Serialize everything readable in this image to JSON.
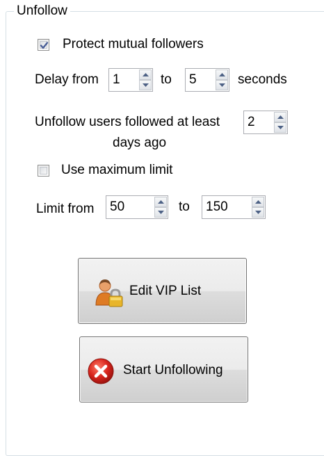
{
  "group": {
    "title": "Unfollow"
  },
  "protect_mutual": {
    "label": "Protect mutual followers",
    "checked": true
  },
  "delay": {
    "prefix": "Delay from",
    "from_value": "1",
    "to_label": "to",
    "to_value": "5",
    "suffix": "seconds"
  },
  "unfollow_age": {
    "label_line1": "Unfollow users followed at least",
    "value": "2",
    "label_line2": "days ago"
  },
  "max_limit": {
    "label": "Use maximum limit",
    "checked": false
  },
  "limit": {
    "prefix": "Limit from",
    "from_value": "50",
    "to_label": "to",
    "to_value": "150"
  },
  "buttons": {
    "edit_vip": "Edit VIP List",
    "start_unfollowing": "Start Unfollowing"
  },
  "icons": {
    "edit_vip": "user-lock-icon",
    "start_unfollowing": "red-x-circle-icon",
    "spin_up": "triangle-up-icon",
    "spin_down": "triangle-down-icon",
    "check": "checkmark-icon"
  },
  "colors": {
    "groupbox_border": "#d5dfe5",
    "checkmark": "#4a5f97",
    "stop_red": "#d8251d",
    "lock_gold": "#d8a51c",
    "user_orange": "#de7b24"
  }
}
